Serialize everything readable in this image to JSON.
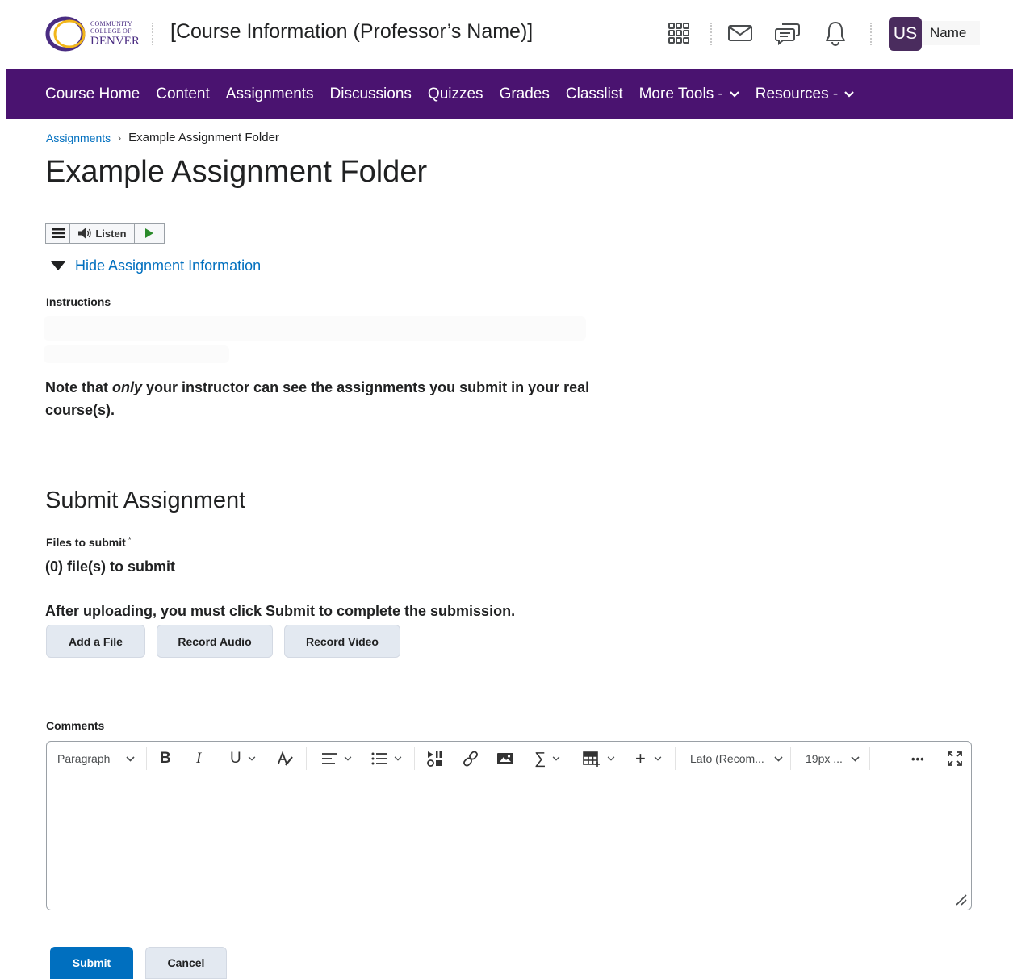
{
  "header": {
    "logo": {
      "line1": "COMMUNITY",
      "line2": "COLLEGE OF",
      "line3": "DENVER",
      "accent": "#4a2c82",
      "ring": "#f2b61a"
    },
    "course_title": "[Course Information (Professor’s Name)]",
    "icons": [
      "grid-icon",
      "mail-icon",
      "chat-icon",
      "bell-icon"
    ],
    "avatar_initials": "US",
    "user_name": "Name"
  },
  "nav": {
    "items": [
      "Course Home",
      "Content",
      "Assignments",
      "Discussions",
      "Quizzes",
      "Grades",
      "Classlist",
      "More Tools -",
      "Resources -"
    ],
    "bg_color": "#4a1370"
  },
  "breadcrumb": {
    "link": "Assignments",
    "separator": "›",
    "current": "Example Assignment Folder"
  },
  "page_title": "Example Assignment Folder",
  "listen_bar": {
    "label": "Listen"
  },
  "assignment_info": {
    "toggle_label": "Hide Assignment Information",
    "instructions_label": "Instructions"
  },
  "note": {
    "prefix": "Note that",
    "emphasis": "only",
    "suffix": "your instructor can see the assignments you submit in your real course(s)."
  },
  "submit_section": {
    "heading": "Submit Assignment",
    "files_label": "Files to submit",
    "required_marker": "*",
    "files_count": "(0) file(s) to submit",
    "after_upload": "After uploading, you must click Submit to complete the submission.",
    "buttons": {
      "add_file": "Add a File",
      "record_audio": "Record Audio",
      "record_video": "Record Video"
    }
  },
  "comments": {
    "label": "Comments",
    "toolbar": {
      "paragraph": "Paragraph",
      "font": "Lato (Recom...",
      "size": "19px ...",
      "more": "•••"
    }
  },
  "actions": {
    "submit": "Submit",
    "cancel": "Cancel"
  },
  "colors": {
    "link": "#006fbf",
    "primary": "#006fbf",
    "button_bg": "#e3e9f1"
  }
}
